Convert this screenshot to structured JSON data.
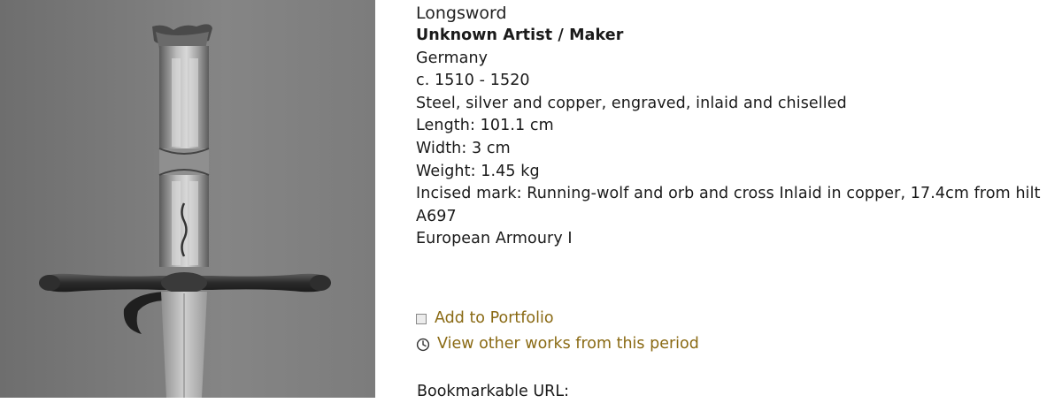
{
  "object": {
    "title": "Longsword",
    "maker": "Unknown Artist / Maker",
    "place": "Germany",
    "date": "c. 1510 - 1520",
    "materials": "Steel, silver and copper, engraved, inlaid and chiselled",
    "length": "Length: 101.1 cm",
    "width": "Width: 3 cm",
    "weight": "Weight: 1.45 kg",
    "mark": "Incised mark: Running-wolf and orb and cross Inlaid in copper, 17.4cm from hilt",
    "accession": "A697",
    "gallery": "European Armoury I"
  },
  "actions": {
    "add_portfolio": "Add to Portfolio",
    "view_period": "View other works from this period",
    "link_color": "#8a6a14"
  },
  "bookmark": {
    "label": "Bookmarkable URL:"
  },
  "icons": {
    "checkbox": "checkbox-icon",
    "clock": "clock-icon"
  }
}
